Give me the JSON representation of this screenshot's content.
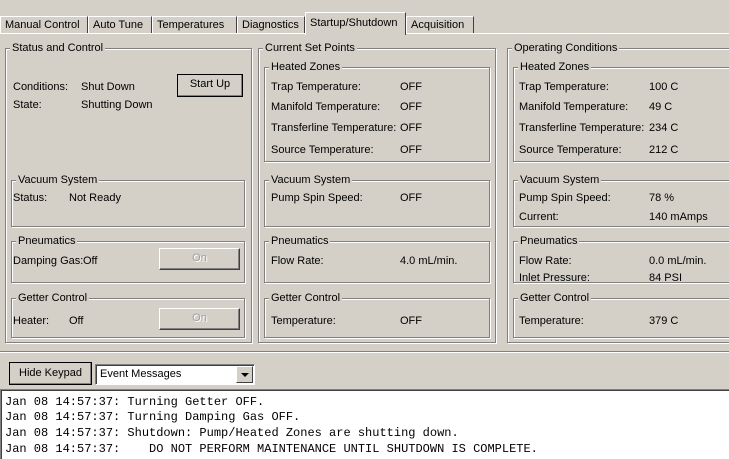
{
  "tabs": [
    {
      "label": "Manual Control"
    },
    {
      "label": "Auto Tune"
    },
    {
      "label": "Temperatures"
    },
    {
      "label": "Diagnostics"
    },
    {
      "label": "Startup/Shutdown"
    },
    {
      "label": "Acquisition"
    }
  ],
  "active_tab": "Startup/Shutdown",
  "status": {
    "title": "Status and Control",
    "conditions_label": "Conditions:",
    "conditions_value": "Shut Down",
    "startup_button": "Start Up",
    "state_label": "State:",
    "state_value": "Shutting Down",
    "vacuum_title": "Vacuum System",
    "vacuum_status_label": "Status:",
    "vacuum_status_value": "Not Ready",
    "pneumatics_title": "Pneumatics",
    "damping_label": "Damping Gas:",
    "damping_value": "Off",
    "damping_button": "On",
    "getter_title": "Getter Control",
    "heater_label": "Heater:",
    "heater_value": "Off",
    "heater_button": "On"
  },
  "setpoints": {
    "title": "Current Set Points",
    "heated_title": "Heated Zones",
    "trap_label": "Trap Temperature:",
    "trap_value": "OFF",
    "manifold_label": "Manifold Temperature:",
    "manifold_value": "OFF",
    "transfer_label": "Transferline Temperature:",
    "transfer_value": "OFF",
    "source_label": "Source Temperature:",
    "source_value": "OFF",
    "vacuum_title": "Vacuum System",
    "pump_label": "Pump Spin Speed:",
    "pump_value": "OFF",
    "pneumatics_title": "Pneumatics",
    "flow_label": "Flow Rate:",
    "flow_value": "4.0 mL/min.",
    "getter_title": "Getter Control",
    "temp_label": "Temperature:",
    "temp_value": "OFF"
  },
  "operating": {
    "title": "Operating Conditions",
    "heated_title": "Heated Zones",
    "trap_label": "Trap Temperature:",
    "trap_value": "100 C",
    "manifold_label": "Manifold Temperature:",
    "manifold_value": "49 C",
    "transfer_label": "Transferline Temperature:",
    "transfer_value": "234 C",
    "source_label": "Source Temperature:",
    "source_value": "212 C",
    "vacuum_title": "Vacuum System",
    "pump_label": "Pump Spin Speed:",
    "pump_value": "78 %",
    "current_label": "Current:",
    "current_value": "140 mAmps",
    "pneumatics_title": "Pneumatics",
    "flow_label": "Flow Rate:",
    "flow_value": "0.0 mL/min.",
    "inlet_label": "Inlet Pressure:",
    "inlet_value": "84 PSI",
    "getter_title": "Getter Control",
    "temp_label": "Temperature:",
    "temp_value": "379 C"
  },
  "bottom": {
    "hide_keypad": "Hide Keypad",
    "message_select": "Event Messages"
  },
  "log": [
    "Jan 08 14:57:37: Turning Getter OFF.",
    "Jan 08 14:57:37: Turning Damping Gas OFF.",
    "Jan 08 14:57:37: Shutdown: Pump/Heated Zones are shutting down.",
    "Jan 08 14:57:37:    DO NOT PERFORM MAINTENANCE UNTIL SHUTDOWN IS COMPLETE."
  ]
}
